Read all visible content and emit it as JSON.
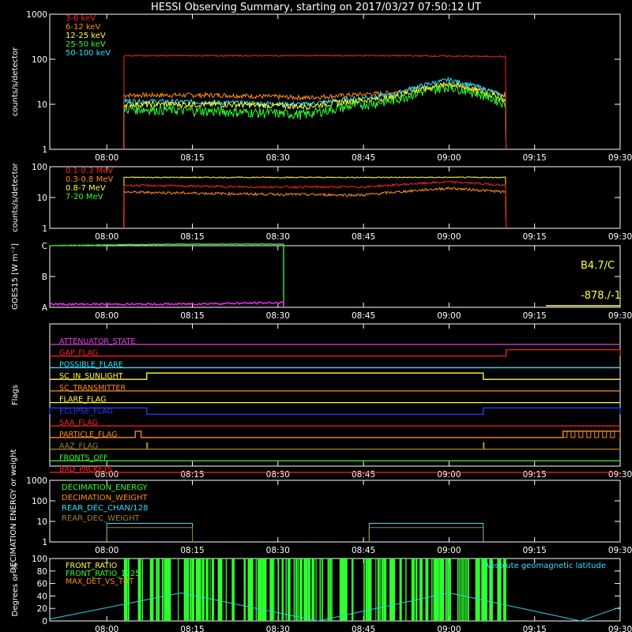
{
  "chart_data": {
    "title": "HESSI Observing Summary, starting on 2017/03/27 07:50:12 UT",
    "x_axis": {
      "start": "07:50",
      "end": "09:30",
      "ticks": [
        "08:00",
        "08:15",
        "08:30",
        "08:45",
        "09:00",
        "09:15",
        "09:30"
      ]
    },
    "panels": [
      {
        "id": "lightcurve-low",
        "type": "line",
        "ylabel": "counts/s/detector",
        "yscale": "log",
        "ylim": [
          1,
          1000
        ],
        "yticks": [
          "1",
          "10",
          "100",
          "1000"
        ],
        "data_window": [
          "08:03",
          "09:10"
        ],
        "series": [
          {
            "name": "3-6 keV",
            "color": "#ff2020",
            "x": [
              "08:03",
              "08:30",
              "08:50",
              "09:10"
            ],
            "y": [
              120,
              120,
              120,
              115
            ]
          },
          {
            "name": "6-12 keV",
            "color": "#ff8c1a",
            "x": [
              "08:03",
              "08:20",
              "08:35",
              "08:50",
              "09:00",
              "09:10"
            ],
            "y": [
              16,
              16,
              14,
              18,
              28,
              16
            ]
          },
          {
            "name": "12-25 keV",
            "color": "#ffff40",
            "x": [
              "08:03",
              "08:20",
              "08:35",
              "08:50",
              "09:00",
              "09:10"
            ],
            "y": [
              10,
              10,
              9,
              14,
              28,
              12
            ]
          },
          {
            "name": "25-50 keV",
            "color": "#30ff30",
            "x": [
              "08:03",
              "08:20",
              "08:35",
              "08:50",
              "09:00",
              "09:10"
            ],
            "y": [
              8,
              7,
              6,
              12,
              25,
              10
            ]
          },
          {
            "name": "50-100 keV",
            "color": "#30e0ff",
            "x": [
              "08:03",
              "08:20",
              "08:35",
              "08:50",
              "09:00",
              "09:10"
            ],
            "y": [
              12,
              11,
              10,
              16,
              35,
              14
            ]
          }
        ]
      },
      {
        "id": "lightcurve-high",
        "type": "line",
        "ylabel": "counts/s/detector",
        "yscale": "log",
        "ylim": [
          1,
          100
        ],
        "yticks": [
          "1",
          "10",
          "100"
        ],
        "data_window": [
          "08:03",
          "09:10"
        ],
        "series": [
          {
            "name": "0.1-0.3 MeV",
            "color": "#ff2020",
            "x": [
              "08:03",
              "08:25",
              "08:45",
              "09:00",
              "09:10"
            ],
            "y": [
              25,
              22,
              22,
              32,
              25
            ]
          },
          {
            "name": "0.3-0.8 MeV",
            "color": "#ff8c1a",
            "x": [
              "08:03",
              "08:25",
              "08:45",
              "09:00",
              "09:10"
            ],
            "y": [
              15,
              13,
              12,
              20,
              15
            ]
          },
          {
            "name": "0.8-7 MeV",
            "color": "#ffff40",
            "x": [
              "08:03",
              "08:30",
              "09:10"
            ],
            "y": [
              45,
              45,
              45
            ]
          },
          {
            "name": "7-20 MeV",
            "color": "#30ff30",
            "x": [],
            "y": []
          }
        ]
      },
      {
        "id": "goes",
        "type": "line",
        "ylabel": "GOES15 [W m⁻²]",
        "yticks": [
          "A",
          "B",
          "C"
        ],
        "annotations": [
          "B4.7/C",
          "-878./-1"
        ],
        "series": [
          {
            "name": "GOES long",
            "color": "#30e030",
            "x": [
              "07:50",
              "08:10",
              "08:31"
            ],
            "y": [
              2.0,
              2.05,
              2.05
            ]
          },
          {
            "name": "GOES short",
            "color": "#ff20ff",
            "x": [
              "07:50",
              "08:10",
              "08:31"
            ],
            "y": [
              0.1,
              0.1,
              0.15
            ]
          }
        ]
      },
      {
        "id": "flags",
        "type": "step",
        "ylabel": "Flags",
        "flags": [
          {
            "name": "ATTENUATOR_STATE",
            "color": "#e040e0",
            "segments": []
          },
          {
            "name": "GAP_FLAG",
            "color": "#ff2020",
            "segments": [
              [
                "09:10",
                "09:30"
              ]
            ]
          },
          {
            "name": "POSSIBLE_FLARE",
            "color": "#30e0ff",
            "segments": []
          },
          {
            "name": "SC_IN_SUNLIGHT",
            "color": "#ffff40",
            "segments": [
              [
                "08:07",
                "09:06"
              ]
            ]
          },
          {
            "name": "SC_TRANSMITTER",
            "color": "#ff8c1a",
            "segments": []
          },
          {
            "name": "FLARE_FLAG",
            "color": "#ffff40",
            "segments": []
          },
          {
            "name": "ECLIPSE_FLAG",
            "color": "#2040ff",
            "segments": [
              [
                "07:50",
                "08:07"
              ],
              [
                "09:06",
                "09:30"
              ]
            ]
          },
          {
            "name": "SAA_FLAG",
            "color": "#ff2020",
            "segments": []
          },
          {
            "name": "PARTICLE_FLAG",
            "color": "#ff8c1a",
            "segments": [
              [
                "08:05",
                "08:06"
              ],
              [
                "09:20",
                "09:30"
              ]
            ]
          },
          {
            "name": "AAZ_FLAG",
            "color": "#a08030",
            "segments": [
              [
                "08:07",
                "08:07"
              ],
              [
                "09:06",
                "09:06"
              ]
            ]
          },
          {
            "name": "FRONTS_OFF",
            "color": "#30ff30",
            "segments": []
          },
          {
            "name": "BAD_PACKETS",
            "color": "#ff2020",
            "segments": []
          }
        ]
      },
      {
        "id": "decimation",
        "type": "step",
        "ylabel": "DECIMATION ENERGY or weight",
        "yscale": "log",
        "ylim": [
          1,
          1000
        ],
        "yticks": [
          "1",
          "10",
          "100",
          "1000"
        ],
        "series": [
          {
            "name": "DECIMATION_ENERGY",
            "color": "#30ff30",
            "x": [],
            "y": []
          },
          {
            "name": "DECIMATION_WEIGHT",
            "color": "#ff8c1a",
            "x": [],
            "y": []
          },
          {
            "name": "REAR_DEC_CHAN/128",
            "color": "#30e0ff",
            "x": [
              "08:00",
              "08:15",
              "08:46",
              "09:06"
            ],
            "y": [
              8,
              8,
              8,
              8
            ]
          },
          {
            "name": "REAR_DEC_WEIGHT",
            "color": "#a08030",
            "x": [
              "08:00",
              "08:15",
              "08:46",
              "09:06"
            ],
            "y": [
              6,
              6,
              6,
              6
            ]
          }
        ]
      },
      {
        "id": "ratios",
        "type": "line",
        "ylabel": "Degrees or %",
        "ylim": [
          0,
          100
        ],
        "yticks": [
          "0",
          "20",
          "40",
          "60",
          "80",
          "100"
        ],
        "right_label": "Absolute geomagnetic latitude",
        "series": [
          {
            "name": "FRONT_RATIO",
            "color": "#ffff40"
          },
          {
            "name": "FRONT_RATIO_1225",
            "color": "#30ff30"
          },
          {
            "name": "MAX_DET_VS_TOT",
            "color": "#ff8c1a"
          },
          {
            "name": "Absolute geomagnetic latitude",
            "color": "#30d0e0",
            "x": [
              "07:50",
              "08:13",
              "08:37",
              "09:00",
              "09:23",
              "09:30"
            ],
            "y": [
              3,
              45,
              0,
              45,
              0,
              22
            ]
          }
        ]
      }
    ]
  }
}
